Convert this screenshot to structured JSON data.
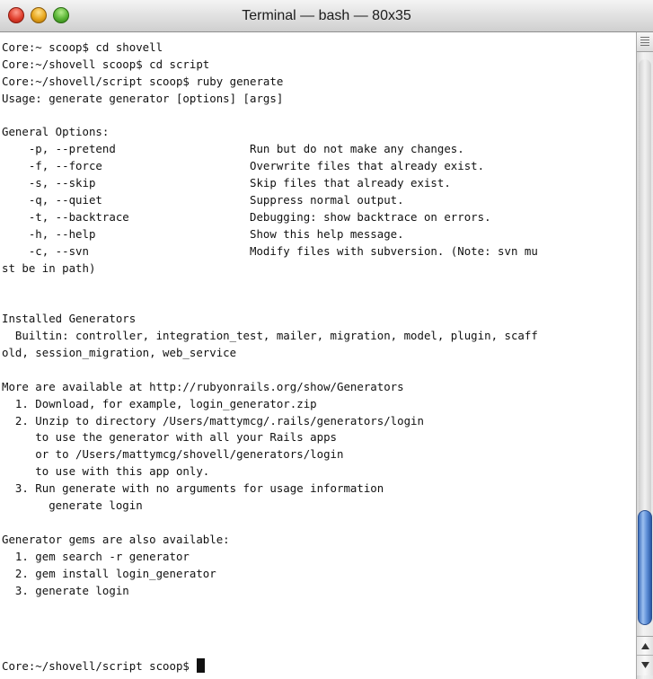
{
  "window": {
    "title": "Terminal — bash — 80x35"
  },
  "icons": {
    "close": "close-button-red",
    "minimize": "minimize-button-yellow",
    "zoom": "zoom-button-green",
    "split": "split-pane-icon",
    "scroll_up": "triangle-up-icon",
    "scroll_down": "triangle-down-icon"
  },
  "colors": {
    "background": "#ffffff",
    "text": "#111111",
    "scroll_thumb": "#5e8fd8"
  },
  "terminal": {
    "lines": [
      "Core:~ scoop$ cd shovell",
      "Core:~/shovell scoop$ cd script",
      "Core:~/shovell/script scoop$ ruby generate",
      "Usage: generate generator [options] [args]",
      "",
      "General Options:",
      "    -p, --pretend                    Run but do not make any changes.",
      "    -f, --force                      Overwrite files that already exist.",
      "    -s, --skip                       Skip files that already exist.",
      "    -q, --quiet                      Suppress normal output.",
      "    -t, --backtrace                  Debugging: show backtrace on errors.",
      "    -h, --help                       Show this help message.",
      "    -c, --svn                        Modify files with subversion. (Note: svn mu",
      "st be in path)",
      "",
      "",
      "Installed Generators",
      "  Builtin: controller, integration_test, mailer, migration, model, plugin, scaff",
      "old, session_migration, web_service",
      "",
      "More are available at http://rubyonrails.org/show/Generators",
      "  1. Download, for example, login_generator.zip",
      "  2. Unzip to directory /Users/mattymcg/.rails/generators/login",
      "     to use the generator with all your Rails apps",
      "     or to /Users/mattymcg/shovell/generators/login",
      "     to use with this app only.",
      "  3. Run generate with no arguments for usage information",
      "       generate login",
      "",
      "Generator gems are also available:",
      "  1. gem search -r generator",
      "  2. gem install login_generator",
      "  3. generate login",
      "",
      "Core:~/shovell/script scoop$ "
    ]
  }
}
